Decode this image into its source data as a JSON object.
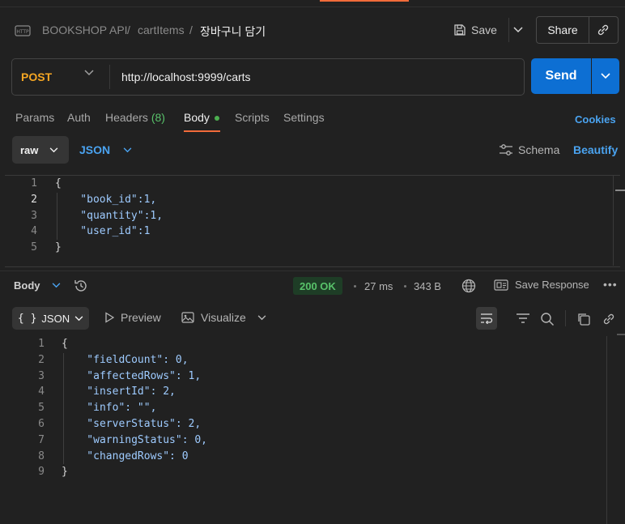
{
  "header": {
    "breadcrumb": [
      "BOOKSHOP API",
      "cartItems",
      "장바구니 담기"
    ],
    "separator": "/",
    "save_label": "Save",
    "share_label": "Share"
  },
  "request": {
    "method": "POST",
    "url": "http://localhost:9999/carts",
    "send_label": "Send"
  },
  "tabs": [
    {
      "label": "Params"
    },
    {
      "label": "Auth"
    },
    {
      "label": "Headers",
      "count": "(8)"
    },
    {
      "label": "Body"
    },
    {
      "label": "Scripts"
    },
    {
      "label": "Settings"
    }
  ],
  "cookies_label": "Cookies",
  "body_type": {
    "mode": "raw",
    "language": "JSON",
    "schema_label": "Schema",
    "beautify_label": "Beautify"
  },
  "request_body": {
    "line_numbers": [
      "1",
      "2",
      "3",
      "4",
      "5"
    ],
    "lines": [
      "{",
      "    \"book_id\":1,",
      "    \"quantity\":1,",
      "    \"user_id\":1",
      "}"
    ]
  },
  "response": {
    "section_label": "Body",
    "status": "200 OK",
    "time": "27 ms",
    "size": "343 B",
    "save_response_label": "Save Response",
    "more_label": "•••",
    "format_label": "JSON",
    "format_glyph": "{ }",
    "preview_label": "Preview",
    "visualize_label": "Visualize",
    "line_numbers": [
      "1",
      "2",
      "3",
      "4",
      "5",
      "6",
      "7",
      "8",
      "9"
    ],
    "lines": [
      "{",
      "    \"fieldCount\": 0,",
      "    \"affectedRows\": 1,",
      "    \"insertId\": 2,",
      "    \"info\": \"\",",
      "    \"serverStatus\": 2,",
      "    \"warningStatus\": 0,",
      "    \"changedRows\": 0",
      "}"
    ]
  },
  "colors": {
    "method": "#f5a623",
    "send": "#0d6fd3",
    "accent": "#f26b3a",
    "link": "#4aa3f0",
    "status_ok": "#58c26a",
    "json_key": "#9ecbff"
  }
}
